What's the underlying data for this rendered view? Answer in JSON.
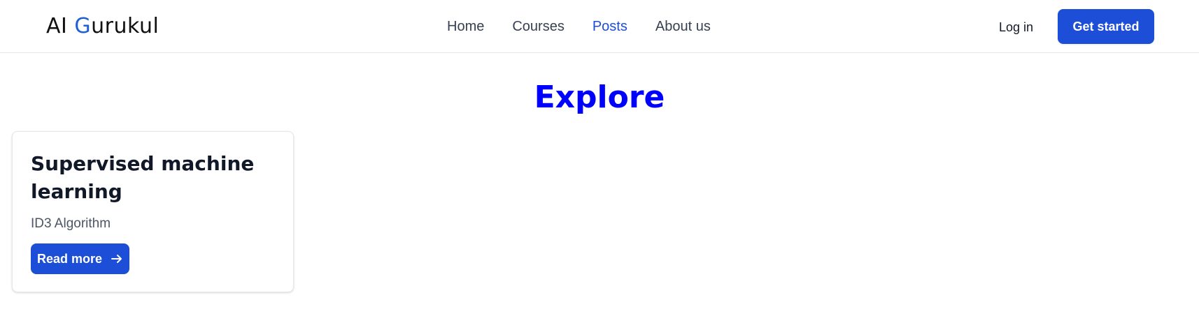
{
  "header": {
    "logo": {
      "part1": "AI ",
      "accent_letter": "G",
      "part2": "urukul"
    },
    "nav": [
      {
        "label": "Home",
        "active": false
      },
      {
        "label": "Courses",
        "active": false
      },
      {
        "label": "Posts",
        "active": true
      },
      {
        "label": "About us",
        "active": false
      }
    ],
    "login_label": "Log in",
    "cta_label": "Get started"
  },
  "main": {
    "title": "Explore",
    "cards": [
      {
        "title": "Supervised machine learning",
        "subtitle": "ID3 Algorithm",
        "button_label": "Read more",
        "button_icon": "arrow-right-icon"
      }
    ]
  },
  "colors": {
    "accent": "#1d4ed8",
    "logo_accent": "#1f5fd6",
    "explore_title": "#0000ff",
    "nav_text": "#374151",
    "border": "#e5e7eb"
  }
}
